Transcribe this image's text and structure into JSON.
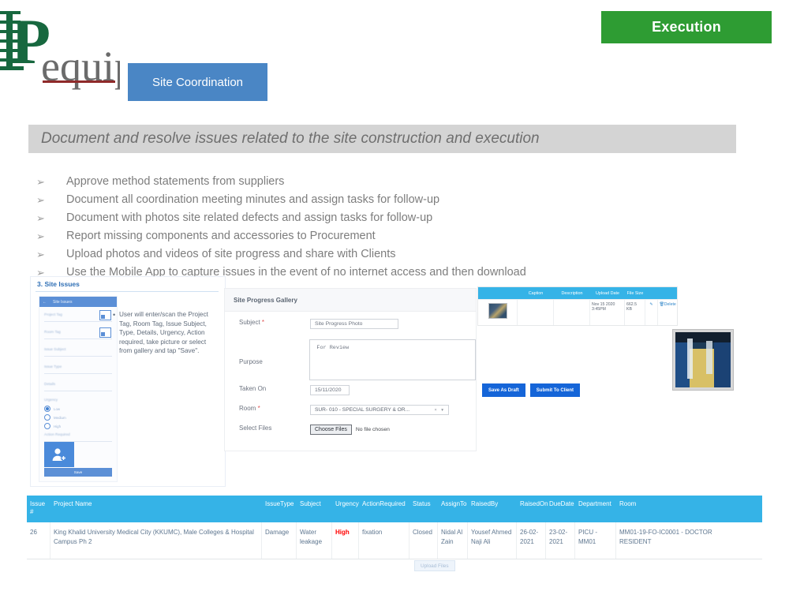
{
  "header": {
    "logo_main": "P",
    "logo_rest": "equip",
    "badge_label": "Execution",
    "badge_color": "#2e9c33",
    "chip_label": "Site Coordination",
    "chip_color": "#4a86c5"
  },
  "subtitle": "Document and resolve issues related to the site construction and execution",
  "bullets": {
    "marker": "➢",
    "items": [
      "Approve method statements from suppliers",
      "Document all coordination meeting minutes and assign tasks for follow-up",
      "Document with photos site related defects and assign tasks for follow-up",
      "Report missing components and accessories to Procurement",
      "Upload photos and videos of site progress and share with Clients",
      "Use the Mobile App to capture issues in the event of no internet access and then download"
    ]
  },
  "mobile_panel": {
    "title": "3. Site Issues",
    "phone_header": "Site Issues",
    "back_icon": "back-arrow-icon",
    "fields": [
      "Project Tag",
      "Room Tag",
      "Issue Subject",
      "Issue Type",
      "Details"
    ],
    "urgency_label": "Urgency",
    "urgency_options": [
      "Low",
      "Medium",
      "High"
    ],
    "urgency_selected": "Low",
    "action_required_label": "Action Required",
    "avatar_icon": "add-user-icon",
    "save_label": "Save",
    "note": "User will enter/scan the Project Tag, Room Tag, Issue Subject, Type, Details, Urgency, Action required, take picture or select from gallery and tap \"Save\"."
  },
  "gallery": {
    "title": "Site Progress Gallery",
    "subject_label": "Subject",
    "subject_value": "Site Progress Photo",
    "purpose_label": "Purpose",
    "purpose_value": "For Review",
    "taken_on_label": "Taken On",
    "taken_on_value": "15/11/2020",
    "room_label": "Room",
    "room_value": "SUR- 010 - SPECIAL SURGERY & OR...",
    "room_caret": "× ▾",
    "select_files_label": "Select Files",
    "choose_files_label": "Choose Files",
    "no_file_text": "No file chosen",
    "upload_label": "Upload Files",
    "required_mark": "*"
  },
  "upload_table": {
    "columns": [
      "",
      "Caption",
      "Description",
      "Upload Date",
      "File Size",
      "",
      ""
    ],
    "rows": [
      {
        "thumb": "site-photo-thumbnail",
        "caption": "",
        "description": "",
        "upload_date": "Nov 15 2020 3:45PM",
        "file_size": "662.5 KB",
        "edit_icon": "edit-icon",
        "delete_label": "Delete"
      }
    ]
  },
  "action_buttons": [
    {
      "label": "Save As Draft"
    },
    {
      "label": "Submit To Client"
    }
  ],
  "photo": {
    "name": "site-construction-photo"
  },
  "issues_table": {
    "header_color": "#35b3e7",
    "columns": [
      "Issue #",
      "Project Name",
      "IssueType",
      "Subject",
      "Urgency",
      "ActionRequired",
      "Status",
      "AssignTo",
      "RaisedBy",
      "RaisedOn",
      "DueDate",
      "Department",
      "Room"
    ],
    "rows": [
      {
        "issue_no": "26",
        "project_name": "King Khalid University Medical City (KKUMC), Male Colleges & Hospital Campus Ph 2",
        "issue_type": "Damage",
        "subject": "Water leakage",
        "urgency": "High",
        "urgency_color": "#ff0000",
        "action_required": "fixation",
        "status": "Closed",
        "assign_to": "Nidal Al Zain",
        "raised_by": "Yousef Ahmed Naji Ali",
        "raised_on": "26-02-2021",
        "due_date": "23-02-2021",
        "department": "PICU - MM01",
        "room": "MM01-19-FO-IC0001 - DOCTOR RESIDENT"
      }
    ]
  }
}
